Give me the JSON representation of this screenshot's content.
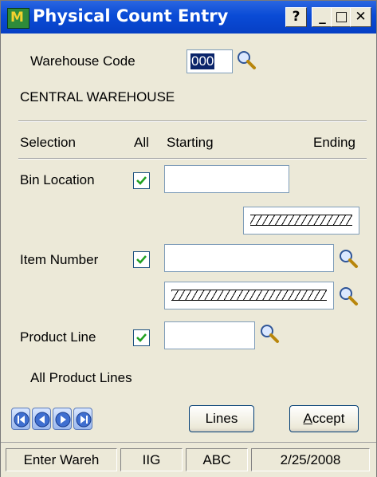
{
  "window": {
    "title": "Physical Count Entry",
    "app_icon_text": "M",
    "title_buttons": {
      "help": "?",
      "minimize": "_",
      "maximize": "□",
      "close": "✕"
    }
  },
  "warehouse": {
    "label": "Warehouse Code",
    "value": "000",
    "description": "CENTRAL WAREHOUSE"
  },
  "selection_header": {
    "selection": "Selection",
    "all": "All",
    "starting": "Starting",
    "ending": "Ending"
  },
  "rows": {
    "bin_location": {
      "label": "Bin Location",
      "all_checked": true,
      "starting": "",
      "ending_disabled": true
    },
    "item_number": {
      "label": "Item Number",
      "all_checked": true,
      "starting": "",
      "ending_disabled": true
    },
    "product_line": {
      "label": "Product Line",
      "all_checked": true,
      "starting": "",
      "description": "All Product Lines"
    }
  },
  "buttons": {
    "lines": "Lines",
    "accept": "Accept",
    "accept_mnemonic": "A"
  },
  "nav": [
    "first-record",
    "previous-record",
    "next-record",
    "last-record"
  ],
  "status_bar": {
    "message": "Enter Wareh",
    "company": "IIG",
    "user": "ABC",
    "date": "2/25/2008"
  },
  "colors": {
    "titlebar": "#0a4bd6",
    "window_bg": "#ece9d8",
    "field_border": "#7f9db9",
    "check_green": "#21a121"
  }
}
